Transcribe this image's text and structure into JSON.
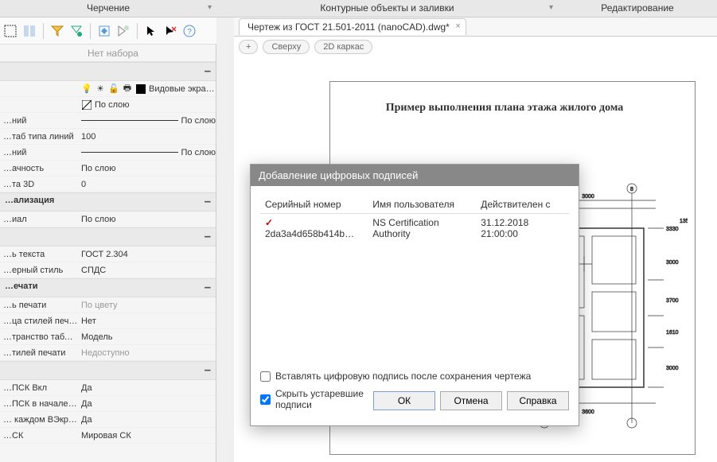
{
  "menu": {
    "left": "Черчение",
    "mid": "Контурные объекты и заливки",
    "right": "Редактирование"
  },
  "document": {
    "tab": "Чертеж из ГОСТ 21.501-2011 (nanoCAD).dwg*"
  },
  "viewbar": {
    "top": "Сверху",
    "wire": "2D каркас"
  },
  "drawing": {
    "title": "Пример выполнения плана этажа жилого дома"
  },
  "props": {
    "header_empty": "",
    "no_selection": "Нет набора",
    "viewports_label": "Видовые экра…",
    "bylayer": "По слою",
    "rows1": [
      {
        "label": "…ний",
        "value": "linetype"
      },
      {
        "label": "…таб типа линий",
        "value": "100"
      },
      {
        "label": "…ний",
        "value": "linetype"
      },
      {
        "label": "…ачность",
        "value": "По слою"
      },
      {
        "label": "…та 3D",
        "value": "0"
      }
    ],
    "section_vis": "…ализация",
    "material": {
      "label": "…иал",
      "value": "По слою"
    },
    "section_text": "",
    "textstyle": {
      "label": "…ь текста",
      "value": "ГОСТ 2.304"
    },
    "dimstyle": {
      "label": "…ерный стиль",
      "value": "СПДС"
    },
    "section_print": "…ечати",
    "printrows": [
      {
        "label": "…ь печати",
        "value": "По цвету",
        "dim": true
      },
      {
        "label": "…ца стилей печати",
        "value": "Нет"
      },
      {
        "label": "…транство таблиц…",
        "value": "Модель"
      },
      {
        "label": "…тилей печати",
        "value": "Недоступно",
        "dim": true
      }
    ],
    "section_ucs": "",
    "ucsrows": [
      {
        "label": "…ПСК Вкл",
        "value": "Да"
      },
      {
        "label": "…ПСК в начале ко…",
        "value": "Да"
      },
      {
        "label": "… каждом ВЭкране",
        "value": "Да"
      },
      {
        "label": "…СК",
        "value": "Мировая СК"
      }
    ]
  },
  "dialog": {
    "title": "Добавление цифровых подписей",
    "col_serial": "Серийный номер",
    "col_user": "Имя пользователя",
    "col_valid": "Действителен с",
    "row1_serial": "2da3a4d658b414b…",
    "row1_user": "NS Certification Authority",
    "row1_valid": "31.12.2018 21:00:00",
    "opt_attach": "Вставлять цифровую подпись после сохранения чертежа",
    "opt_hide": "Скрыть устаревшие подписи",
    "btn_ok": "ОК",
    "btn_cancel": "Отмена",
    "btn_help": "Справка"
  }
}
